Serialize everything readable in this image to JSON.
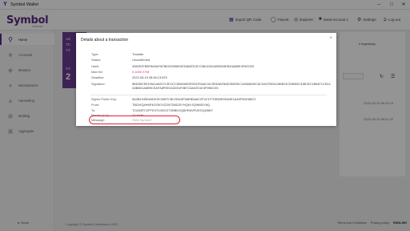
{
  "window": {
    "title": "Symbol Wallet",
    "minimize": "–",
    "maximize": "□",
    "close": "✕"
  },
  "header": {
    "logo": "Symbol",
    "logo_sub": "TESTNET",
    "items": [
      {
        "label": "Import QR Code",
        "icon": "qr-icon"
      },
      {
        "label": "Faucet",
        "icon": "faucet-icon"
      },
      {
        "label": "Explorer",
        "icon": "explorer-icon"
      },
      {
        "label": "Seed Account 1",
        "icon": "account-icon"
      },
      {
        "label": "Settings",
        "icon": "gear-icon"
      },
      {
        "label": "Log out",
        "icon": "logout-icon"
      }
    ]
  },
  "sidebar": {
    "items": [
      {
        "label": "Home",
        "icon": "home-icon",
        "active": true
      },
      {
        "label": "Accounts",
        "icon": "accounts-icon",
        "active": false
      },
      {
        "label": "Mosaics",
        "icon": "mosaics-icon",
        "active": false
      },
      {
        "label": "Namespaces",
        "icon": "namespaces-icon",
        "active": false
      },
      {
        "label": "Harvesting",
        "icon": "harvesting-icon",
        "active": false
      },
      {
        "label": "Multisig",
        "icon": "multisig-icon",
        "active": false
      },
      {
        "label": "Aggregate",
        "icon": "aggregate-icon",
        "active": false
      }
    ],
    "footer": "Node"
  },
  "main": {
    "left_panel": {
      "line1": "Ad",
      "line2": "TC",
      "line3": "Y3",
      "line4": "XY",
      "line5": "2"
    },
    "right_card": {
      "text": "e legendary",
      "dates": [
        "2022-08-19 06:49:13",
        "2022-08-19 06:51:42"
      ]
    },
    "footer_left": "Copyright © Symbol Contributors 2022",
    "footer_right": {
      "terms": "Terms and Conditions",
      "privacy": "Privacy policy",
      "lang": "ENGLISH"
    }
  },
  "modal": {
    "title": "Details about a transaction",
    "close": "×",
    "fields": [
      {
        "key": "Type:",
        "value": "Transfer"
      },
      {
        "key": "Status:",
        "value": "Unconfirmed"
      },
      {
        "key": "Hash:",
        "value": "4980E2FB8F8A9AFAFB0323098E0E5483ED3CC5B14DDAEB0D6EB43A5BE4F80C5D"
      },
      {
        "key": "Max fee:",
        "value": "0.1000 XYM"
      },
      {
        "key": "Deadline:",
        "value": "2022-08-19 08:46:13:875"
      },
      {
        "key": "Signature:",
        "value": "8BD65CEED9A1A6207CB7A7C5BA98D5F0DDFA6A7AC9E63AF8AE35DE5C1496AB30C6C0A1F5EAC8E8D3C28E89C43B76C1B64F1CE44A5B8D1A6B9CEAFA8F5E2A3D51F8B7C6A22D1E3F9B4C05"
      },
      {
        "key": "Signer Public Key:",
        "value": "5A3B1945D64DE5C09EFCBC0DA9F3BEB5A6C2F4C1F7DB90E9D84E1AA0FB1E6BC2"
      },
      {
        "key": "From:",
        "value": "TBDVIQ4H6P4GS5OXZZN7DBDZIYHQ6YJQ9N5DY6Q"
      },
      {
        "key": "To:",
        "value": "TCAN5TC2FFKX7LMCKZ7XBBKGQ6HRAVPUKGQUB6Y"
      },
      {
        "key": "Mosaic (1/1):",
        "value": "10 XYM"
      },
      {
        "key": "Message:",
        "value": "Hello Symbol!"
      }
    ]
  }
}
